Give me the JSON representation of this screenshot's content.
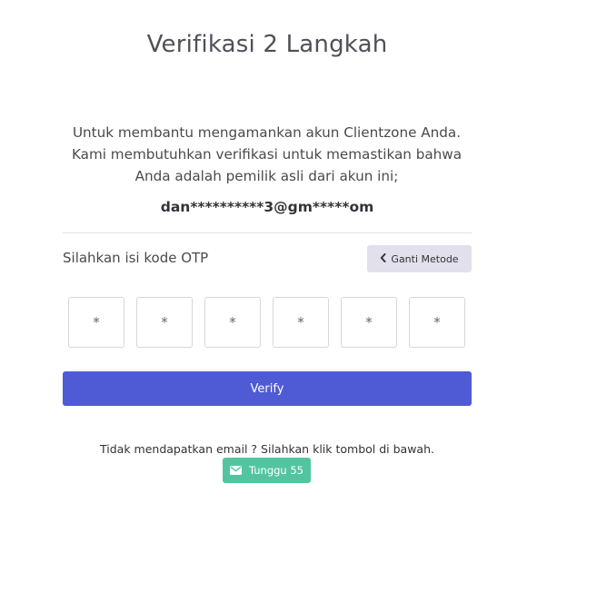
{
  "page": {
    "title": "Verifikasi 2 Langkah"
  },
  "intro": {
    "text": "Untuk membantu mengamankan akun Clientzone Anda. Kami membutuhkan verifikasi untuk memastikan bahwa Anda adalah pemilik asli dari akun ini;",
    "masked_email": "dan**********3@gm*****om"
  },
  "otp": {
    "label": "Silahkan isi kode OTP",
    "change_method_label": "Ganti Metode",
    "change_method_icon": "chevron-left-icon",
    "digits": [
      {
        "placeholder": "*",
        "value": ""
      },
      {
        "placeholder": "*",
        "value": ""
      },
      {
        "placeholder": "*",
        "value": ""
      },
      {
        "placeholder": "*",
        "value": ""
      },
      {
        "placeholder": "*",
        "value": ""
      },
      {
        "placeholder": "*",
        "value": ""
      }
    ]
  },
  "verify": {
    "label": "Verify"
  },
  "resend": {
    "note": "Tidak mendapatkan email ? Silahkan klik tombol di bawah.",
    "button_label": "Tunggu 55",
    "button_icon": "envelope-icon"
  },
  "colors": {
    "primary": "#4f5bd5",
    "success": "#52c5a0",
    "secondary": "#e1e0ec"
  }
}
